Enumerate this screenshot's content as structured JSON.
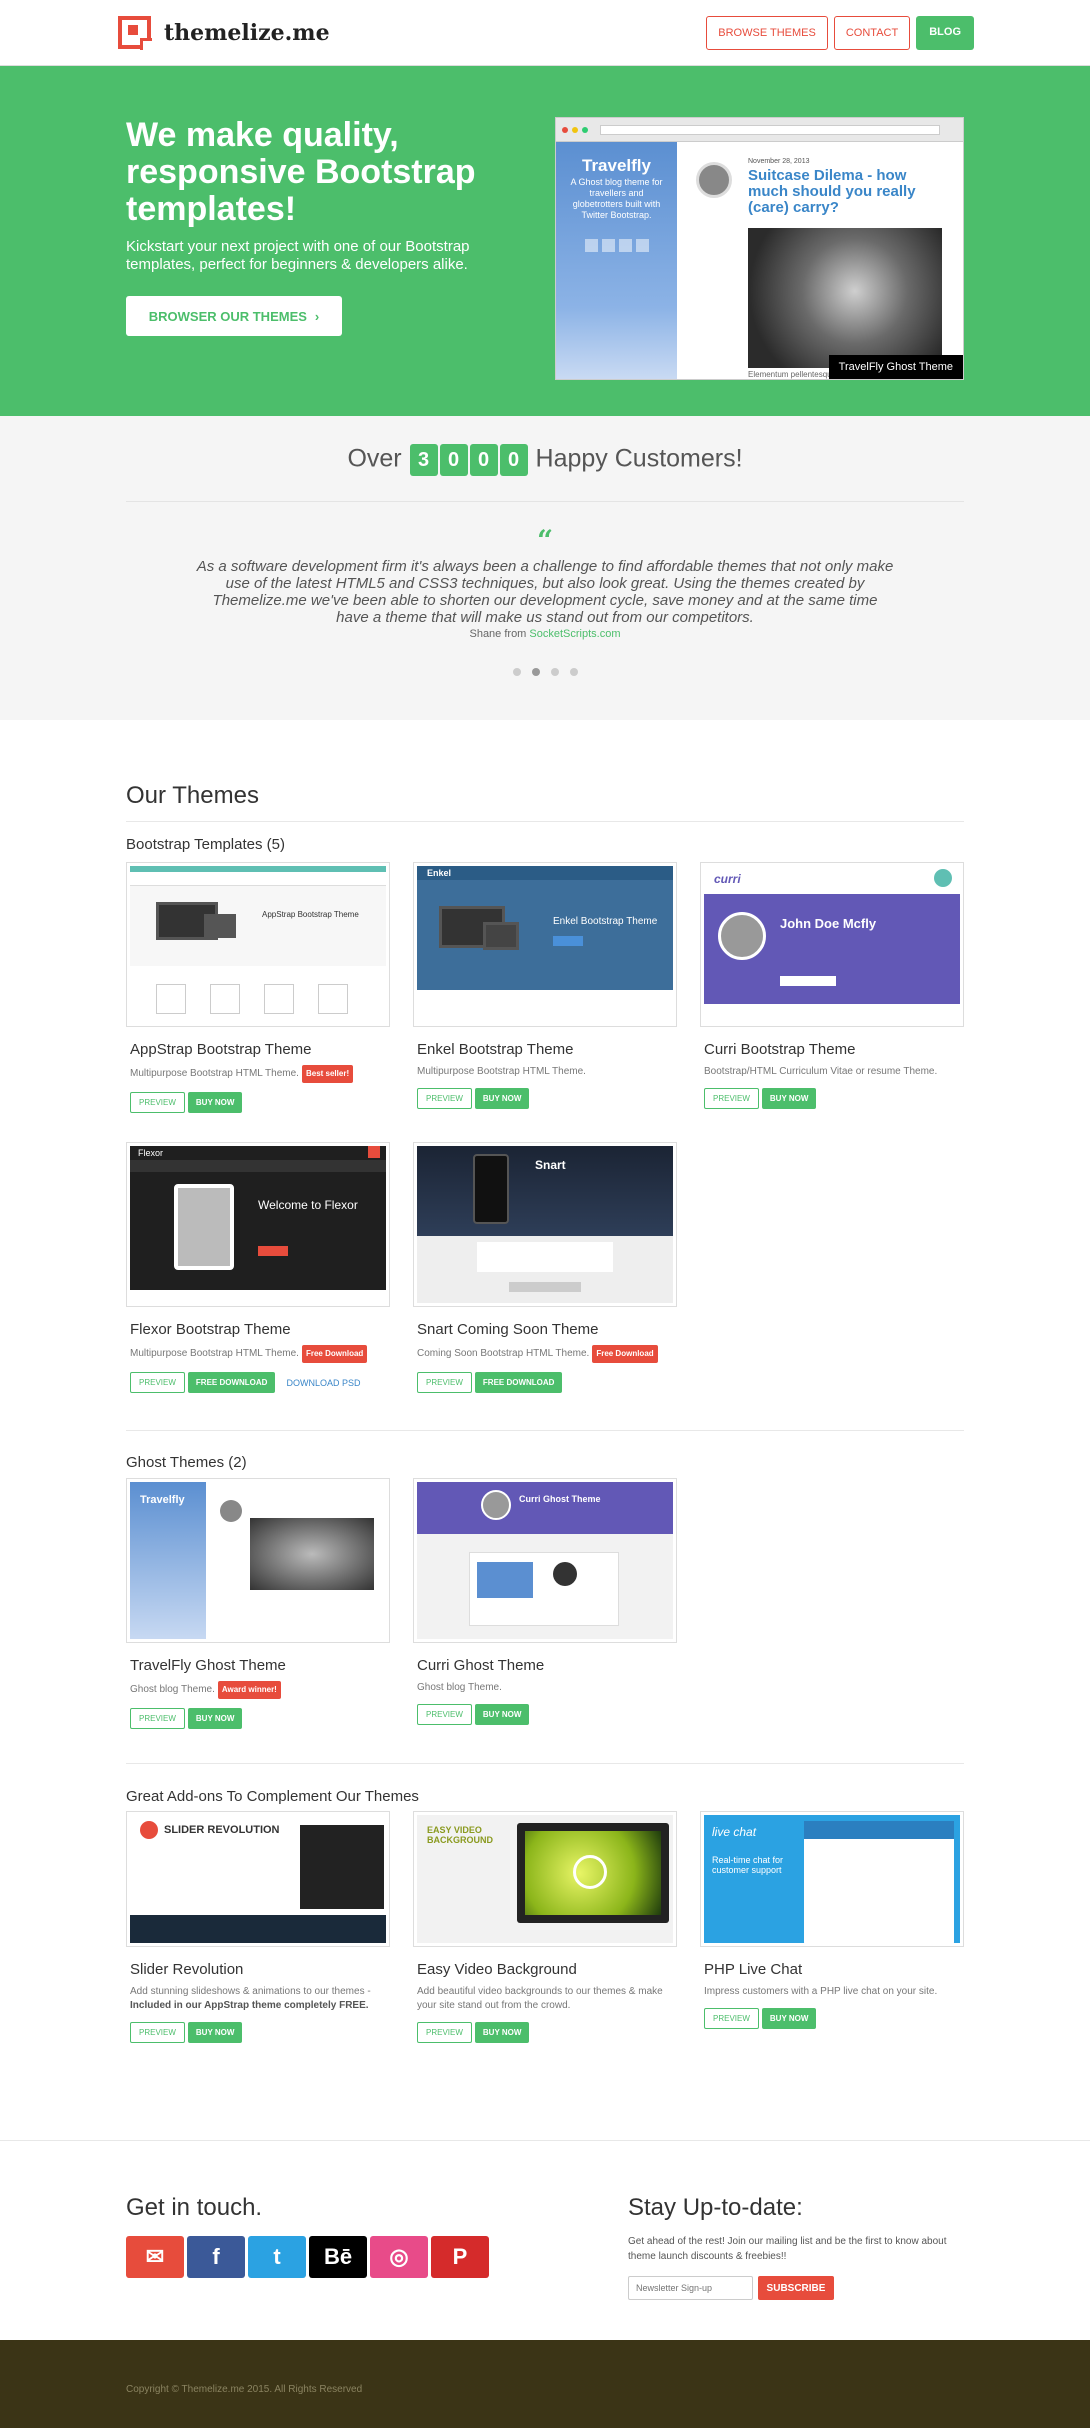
{
  "brand": {
    "name": "themelize.me"
  },
  "nav": {
    "browse": "BROWSE THEMES",
    "contact": "CONTACT",
    "blog": "BLOG"
  },
  "hero": {
    "title": "We make quality, responsive Bootstrap templates!",
    "subtitle": "Kickstart your next project with one of our Bootstrap templates, perfect for beginners & developers alike.",
    "button": "BROWSER OUR THEMES",
    "preview": {
      "logo": "Travelfly",
      "tagline": "A Ghost blog theme for travellers and globetrotters built with Twitter Bootstrap.",
      "date": "November 28, 2013",
      "post_title": "Suitcase Dilema - how much should you really (care) carry?",
      "excerpt": "Elementum pellentesque habitant",
      "caption": "TravelFly Ghost Theme"
    }
  },
  "counter": {
    "prefix": "Over",
    "digits": [
      "3",
      "0",
      "0",
      "0"
    ],
    "suffix": "Happy Customers!"
  },
  "testimonial": {
    "quote": "As a software development firm it's always been a challenge to find affordable themes that not only make use of the latest HTML5 and CSS3 techniques, but also look great. Using the themes created by Themelize.me we've been able to shorten our development cycle, save money and at the same time have a theme that will make us stand out from our competitors.",
    "source_prefix": "Shane from",
    "source_link": "SocketScripts.com",
    "active_slide": 2
  },
  "themes": {
    "title": "Our Themes",
    "categories": {
      "bootstrap": {
        "title": "Bootstrap Templates (5)",
        "items": [
          {
            "name": "AppStrap Bootstrap Theme",
            "desc": "Multipurpose Bootstrap HTML Theme.",
            "badge": "Best seller!",
            "preview": "PREVIEW",
            "buy": "BUY NOW"
          },
          {
            "name": "Enkel Bootstrap Theme",
            "desc": "Multipurpose Bootstrap HTML Theme.",
            "preview": "PREVIEW",
            "buy": "BUY NOW"
          },
          {
            "name": "Curri Bootstrap Theme",
            "desc": "Bootstrap/HTML Curriculum Vitae or resume Theme.",
            "preview": "PREVIEW",
            "buy": "BUY NOW"
          },
          {
            "name": "Flexor Bootstrap Theme",
            "desc": "Multipurpose Bootstrap HTML Theme.",
            "badge": "Free Download",
            "preview": "PREVIEW",
            "buy": "FREE DOWNLOAD",
            "extra": "DOWNLOAD PSD"
          },
          {
            "name": "Snart Coming Soon Theme",
            "desc": "Coming Soon Bootstrap HTML Theme.",
            "badge": "Free Download",
            "preview": "PREVIEW",
            "buy": "FREE DOWNLOAD"
          }
        ]
      },
      "ghost": {
        "title": "Ghost Themes (2)",
        "items": [
          {
            "name": "TravelFly Ghost Theme",
            "desc": "Ghost blog Theme.",
            "badge": "Award winner!",
            "preview": "PREVIEW",
            "buy": "BUY NOW"
          },
          {
            "name": "Curri Ghost Theme",
            "desc": "Ghost blog Theme.",
            "preview": "PREVIEW",
            "buy": "BUY NOW"
          }
        ]
      },
      "addons": {
        "title": "Great Add-ons To Complement Our Themes",
        "items": [
          {
            "name": "Slider Revolution",
            "desc": "Add stunning slideshows & animations to our themes - ",
            "desc_bold": "Included in our AppStrap theme completely FREE.",
            "preview": "PREVIEW",
            "buy": "BUY NOW"
          },
          {
            "name": "Easy Video Background",
            "desc": "Add beautiful video backgrounds to our themes & make your site stand out from the crowd.",
            "preview": "PREVIEW",
            "buy": "BUY NOW"
          },
          {
            "name": "PHP Live Chat",
            "desc": "Impress customers with a PHP live chat on your site.",
            "preview": "PREVIEW",
            "buy": "BUY NOW"
          }
        ]
      }
    },
    "thumbs": {
      "appstrap": "AppStrap Bootstrap Theme",
      "enkel": "Enkel Bootstrap Theme",
      "enkel_logo": "Enkel",
      "curri_name": "John Doe Mcfly",
      "curri_logo": "curri",
      "flexor": "Welcome to Flexor",
      "flexor_logo": "Flexor",
      "snart": "Snart",
      "curri_ghost": "Curri Ghost Theme",
      "slider": "SLIDER REVOLUTION",
      "video": "EASY VIDEO BACKGROUND",
      "chat": "Real-time chat for customer support",
      "chat_logo": "live chat"
    }
  },
  "contact": {
    "title": "Get in touch.",
    "socials": [
      {
        "icon": "envelope-icon",
        "glyph": "✉",
        "color": "#e74c3c"
      },
      {
        "icon": "facebook-icon",
        "glyph": "f",
        "color": "#3b5998"
      },
      {
        "icon": "twitter-icon",
        "glyph": "t",
        "color": "#2ba2e2"
      },
      {
        "icon": "behance-icon",
        "glyph": "Bē",
        "color": "#000000"
      },
      {
        "icon": "dribbble-icon",
        "glyph": "◎",
        "color": "#e84b89"
      },
      {
        "icon": "pinterest-icon",
        "glyph": "P",
        "color": "#d52b2b"
      }
    ]
  },
  "newsletter": {
    "title": "Stay Up-to-date:",
    "text": "Get ahead of the rest! Join our mailing list and be the first to know about theme launch discounts & freebies!!",
    "placeholder": "Newsletter Sign-up",
    "button": "SUBSCRIBE"
  },
  "footer": {
    "copyright": "Copyright © Themelize.me 2015. All Rights Reserved"
  }
}
